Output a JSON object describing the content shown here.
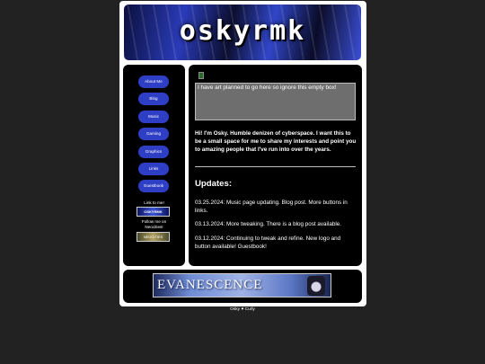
{
  "header": {
    "logo_text": "oskyrmk"
  },
  "nav": {
    "items": [
      {
        "label": "About Me"
      },
      {
        "label": "Blog"
      },
      {
        "label": "Music"
      },
      {
        "label": "Gaming"
      },
      {
        "label": "Graphics"
      },
      {
        "label": "Links"
      },
      {
        "label": "Guestbook"
      }
    ]
  },
  "sidebar": {
    "link_to_me": "Link to me!",
    "osky_badge_text": "OSKYRMK",
    "follow_text_line1": "Follow me on",
    "follow_text_line2": "Neocities!",
    "neocities_badge_text": "NEOCITIES"
  },
  "main": {
    "art_alt_text": "I have art planned to go here so ignore this empty box!",
    "intro": "Hi! I'm Osky. Humble denizen of cyberspace. I want this to be a small space for me to share my interests and point you to amazing people that I've run into over the years.",
    "updates_title": "Updates:",
    "updates": [
      "03.25.2024: Music page updating. Blog post. More buttons in links.",
      "03.13.2024: More tweaking. There is a blog post available.",
      "03.12.2024: Continuing to tweak and refine. New logo and button available! Guestbook!"
    ]
  },
  "footer": {
    "banner_text": "EVANESCENCE",
    "credit_left": "Osky",
    "credit_heart": "♥",
    "credit_right": "Curly"
  }
}
